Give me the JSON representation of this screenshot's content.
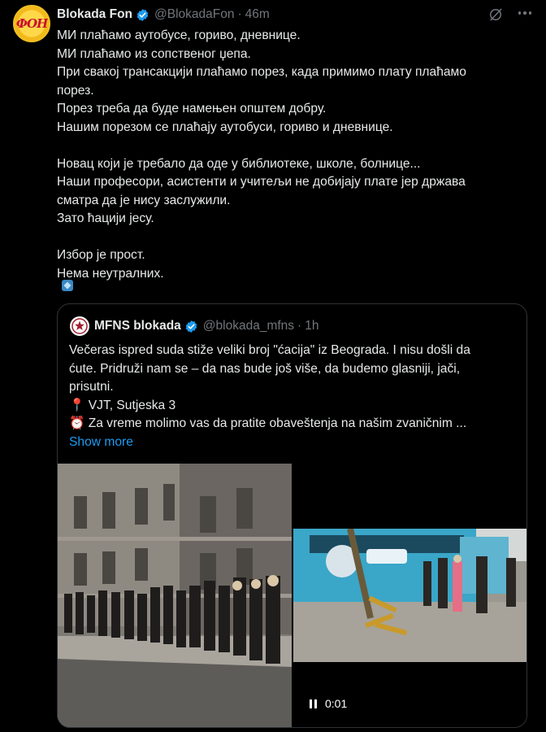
{
  "post": {
    "display_name": "Blokada Fon",
    "handle": "@BlokadaFon",
    "separator": "·",
    "time": "46m",
    "avatar_text": "ФОН",
    "lines": [
      "МИ плаћамо аутобусе, гориво, дневнице.",
      "МИ плаћамо из сопственог џепа.",
      "При свакој трансакцији плаћамо порез, када примимо плату плаћамо",
      "порез.",
      "Порез треба да буде намењен општем добру.",
      "Нашим порезом се плаћају аутобуси, гориво и дневнице.",
      "",
      "Новац који је требало да оде у библиотеке, школе, болнице...",
      "Наши професори, асистенти и учитељи не добијају плате јер држава",
      "сматра да је нису заслужили.",
      "Зато ћацији јесу.",
      "",
      "Избор је прост.",
      "Нема неутралних."
    ]
  },
  "quote": {
    "display_name": "MFNS blokada",
    "handle": "@blokada_mfns",
    "separator": "·",
    "time": "1h",
    "lines": [
      "Večeras ispred suda stiže veliki broj \"ćacija\" iz Beograda. I nisu došli da",
      "ćute. Pridruži nam se – da nas bude još više, da budemo glasniji, jači,",
      "prisutni.",
      "📍 VJT, Sutjeska 3",
      "⏰ Za vreme molimo vas da pratite obaveštenja na našim zvaničnim ..."
    ],
    "show_more": "Show more",
    "video_time": "0:01"
  },
  "colors": {
    "background": "#000000",
    "text": "#e7e9ea",
    "muted": "#71767b",
    "link": "#1d9bf0",
    "verified": "#1d9bf0",
    "border": "#2f3336"
  }
}
